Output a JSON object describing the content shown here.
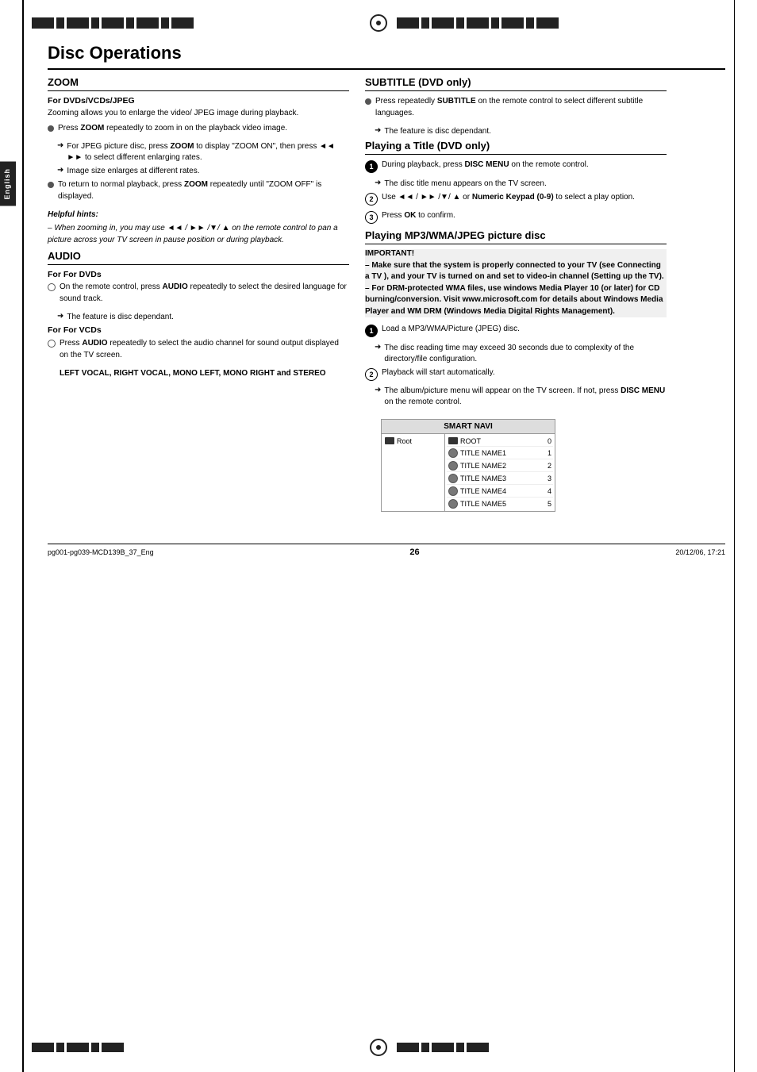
{
  "page": {
    "title": "Disc Operations",
    "page_number": "26",
    "footer_left": "pg001-pg039-MCD139B_37_Eng",
    "footer_center": "26",
    "footer_right": "20/12/06, 17:21",
    "language_tab": "English"
  },
  "left_column": {
    "zoom_section": {
      "title": "ZOOM",
      "sub_label": "For DVDs/VCDs/JPEG",
      "intro": "Zooming allows you to enlarge the video/ JPEG image during playback.",
      "bullet1": {
        "text": "Press ZOOM repeatedly to zoom in on the playback video image.",
        "bold_word": "ZOOM"
      },
      "arrow1": "For JPEG picture disc, press ZOOM to display \"ZOOM ON\", then press ◄◄ ►► to select different enlarging rates.",
      "arrow2": "Image size enlarges at different rates.",
      "bullet2": {
        "text": "To return to normal playback, press ZOOM repeatedly until \"ZOOM OFF\" is displayed.",
        "bold_word": "ZOOM"
      },
      "helpful_hints_title": "Helpful hints:",
      "hints_text": "– When zooming in, you may use ◄◄ / ►► /▼/ ▲ on the remote control to pan a picture across your TV screen in pause position or during playback."
    },
    "audio_section": {
      "title": "AUDIO",
      "dvds_label": "For DVDs",
      "dvds_text": "On the remote control, press AUDIO repeatedly to select the desired language for sound track.",
      "dvds_arrow": "The feature is disc dependant.",
      "vcds_label": "For VCDs",
      "vcds_text": "Press AUDIO repeatedly to select the audio channel for sound output displayed on the TV screen.",
      "vcds_bold": "LEFT VOCAL, RIGHT VOCAL, MONO LEFT, MONO RIGHT and STEREO"
    }
  },
  "right_column": {
    "subtitle_section": {
      "title": "SUBTITLE (DVD only)",
      "bullet1": "Press repeatedly SUBTITLE on the remote control to select different subtitle languages.",
      "arrow1": "The feature is disc dependant."
    },
    "playing_title_section": {
      "title": "Playing a Title (DVD only)",
      "step1": "During playback, press DISC MENU on the remote control.",
      "step1_arrow": "The disc title menu appears on the TV screen.",
      "step2": "Use ◄◄ / ►► /▼/ ▲ or Numeric Keypad (0-9) to select a play option.",
      "step3": "Press OK to confirm."
    },
    "playing_mp3_section": {
      "title": "Playing MP3/WMA/JPEG picture disc",
      "important_label": "IMPORTANT!",
      "important_text1": "– Make sure that the system is properly connected to your TV (see Connecting a TV ), and your TV is turned on and set to video-in channel (Setting up the TV).",
      "important_text2": "– For DRM-protected WMA files, use windows Media Player 10 (or later) for CD burning/conversion. Visit www.microsoft.com for details about Windows Media Player and WM DRM (Windows Media Digital Rights Management).",
      "step1": "Load a MP3/WMA/Picture (JPEG) disc.",
      "step1_arrow": "The disc reading time may exceed 30 seconds due to complexity of the directory/file configuration.",
      "step2": "Playback will start automatically.",
      "step2_arrow": "The album/picture menu will appear on the TV screen. If not, press DISC MENU on the remote control."
    },
    "smart_navi": {
      "header": "SMART NAVI",
      "left_root": "Root",
      "rows": [
        {
          "icon": "folder",
          "label": "ROOT",
          "number": "0"
        },
        {
          "icon": "disc",
          "label": "TITLE NAME1",
          "number": "1"
        },
        {
          "icon": "disc",
          "label": "TITLE NAME2",
          "number": "2"
        },
        {
          "icon": "disc",
          "label": "TITLE NAME3",
          "number": "3"
        },
        {
          "icon": "disc",
          "label": "TITLE NAME4",
          "number": "4"
        },
        {
          "icon": "disc",
          "label": "TITLE NAME5",
          "number": "5"
        }
      ]
    }
  }
}
